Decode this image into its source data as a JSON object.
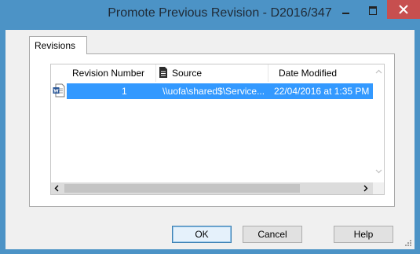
{
  "window": {
    "title": "Promote Previous Revision - D2016/347",
    "colors": {
      "frame": "#4c93c6",
      "close": "#c74f4f",
      "selection": "#3399ff"
    }
  },
  "tabs": [
    {
      "label": "Revisions",
      "active": true
    }
  ],
  "list": {
    "columns": [
      {
        "label": "Revision Number"
      },
      {
        "label": "Source",
        "icon": "document-icon"
      },
      {
        "label": "Date Modified"
      }
    ],
    "rows": [
      {
        "icon": "word-document-icon",
        "selected": true,
        "revision_number": "1",
        "source": "\\\\uofa\\shared$\\Service...",
        "date_modified": "22/04/2016 at 1:35 PM"
      }
    ]
  },
  "buttons": {
    "ok": "OK",
    "cancel": "Cancel",
    "help": "Help"
  }
}
